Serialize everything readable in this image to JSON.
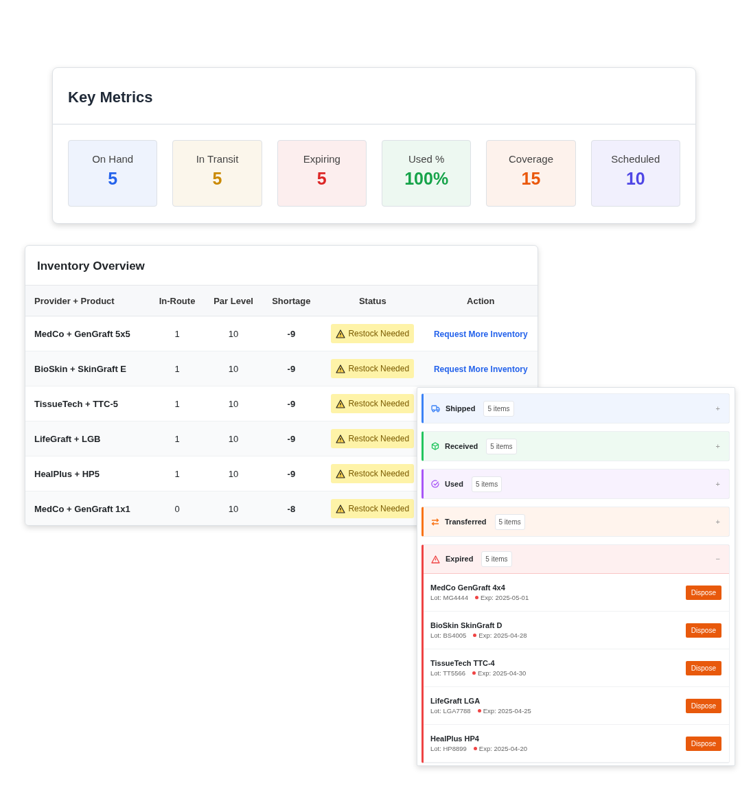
{
  "key_metrics": {
    "title": "Key Metrics",
    "metrics": [
      {
        "label": "On Hand",
        "value": "5",
        "color": "#2563eb"
      },
      {
        "label": "In Transit",
        "value": "5",
        "color": "#ca8a04"
      },
      {
        "label": "Expiring",
        "value": "5",
        "color": "#dc2626"
      },
      {
        "label": "Used %",
        "value": "100%",
        "color": "#16a34a"
      },
      {
        "label": "Coverage",
        "value": "15",
        "color": "#ea580c"
      },
      {
        "label": "Scheduled",
        "value": "10",
        "color": "#4f46e5"
      }
    ]
  },
  "inventory": {
    "title": "Inventory Overview",
    "columns": [
      "Provider + Product",
      "In-Route",
      "Par Level",
      "Shortage",
      "Status",
      "Action"
    ],
    "rows": [
      {
        "product": "MedCo + GenGraft 5x5",
        "in_route": "1",
        "par_level": "10",
        "shortage": "-9",
        "status": "Restock Needed",
        "action": "Request More Inventory"
      },
      {
        "product": "BioSkin + SkinGraft E",
        "in_route": "1",
        "par_level": "10",
        "shortage": "-9",
        "status": "Restock Needed",
        "action": "Request More Inventory"
      },
      {
        "product": "TissueTech + TTC-5",
        "in_route": "1",
        "par_level": "10",
        "shortage": "-9",
        "status": "Restock Needed"
      },
      {
        "product": "LifeGraft + LGB",
        "in_route": "1",
        "par_level": "10",
        "shortage": "-9",
        "status": "Restock Needed"
      },
      {
        "product": "HealPlus + HP5",
        "in_route": "1",
        "par_level": "10",
        "shortage": "-9",
        "status": "Restock Needed"
      },
      {
        "product": "MedCo + GenGraft 1x1",
        "in_route": "0",
        "par_level": "10",
        "shortage": "-8",
        "status": "Restock Needed"
      }
    ]
  },
  "sections": [
    {
      "kind": "shipped",
      "label": "Shipped",
      "count": "5 items",
      "color": "#3b82f6",
      "toggle": "+",
      "expanded": false
    },
    {
      "kind": "received",
      "label": "Received",
      "count": "5 items",
      "color": "#22c55e",
      "toggle": "+",
      "expanded": false
    },
    {
      "kind": "used",
      "label": "Used",
      "count": "5 items",
      "color": "#a855f7",
      "toggle": "+",
      "expanded": false
    },
    {
      "kind": "transferred",
      "label": "Transferred",
      "count": "5 items",
      "color": "#f97316",
      "toggle": "+",
      "expanded": false
    },
    {
      "kind": "expired",
      "label": "Expired",
      "count": "5 items",
      "color": "#ef4444",
      "toggle": "−",
      "expanded": true,
      "items": [
        {
          "name": "MedCo GenGraft 4x4",
          "lot": "Lot: MG4444",
          "exp": "Exp: 2025-05-01",
          "button": "Dispose"
        },
        {
          "name": "BioSkin SkinGraft D",
          "lot": "Lot: BS4005",
          "exp": "Exp: 2025-04-28",
          "button": "Dispose"
        },
        {
          "name": "TissueTech TTC-4",
          "lot": "Lot: TT5566",
          "exp": "Exp: 2025-04-30",
          "button": "Dispose"
        },
        {
          "name": "LifeGraft LGA",
          "lot": "Lot: LGA7788",
          "exp": "Exp: 2025-04-25",
          "button": "Dispose"
        },
        {
          "name": "HealPlus HP4",
          "lot": "Lot: HP8899",
          "exp": "Exp: 2025-04-20",
          "button": "Dispose"
        }
      ]
    }
  ]
}
